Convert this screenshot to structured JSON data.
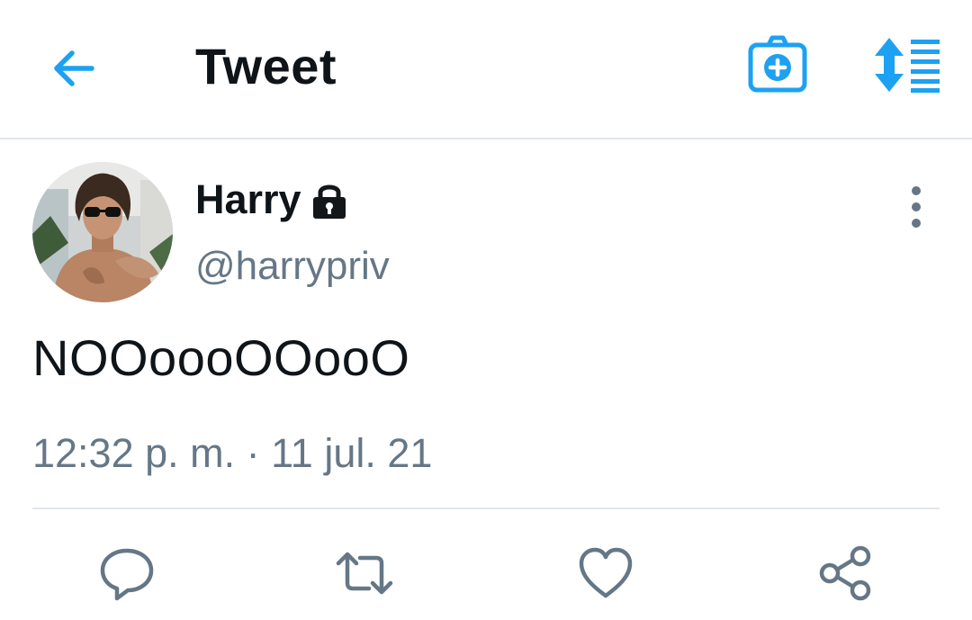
{
  "header": {
    "title": "Tweet",
    "back_icon": "arrow-left-icon",
    "camera_icon": "camera-plus-icon",
    "expand_icon": "expand-thread-icon",
    "accent_color": "#1da1f2"
  },
  "tweet": {
    "author_name": "Harry",
    "protected_icon": "lock-icon",
    "handle": "@harrypriv",
    "text": "NOOoooOOooO",
    "timestamp": "12:32 p. m. · 11 jul. 21"
  },
  "actions": {
    "reply_icon": "reply-icon",
    "retweet_icon": "retweet-icon",
    "like_icon": "heart-icon",
    "share_icon": "share-icon",
    "icon_color": "#657786"
  }
}
